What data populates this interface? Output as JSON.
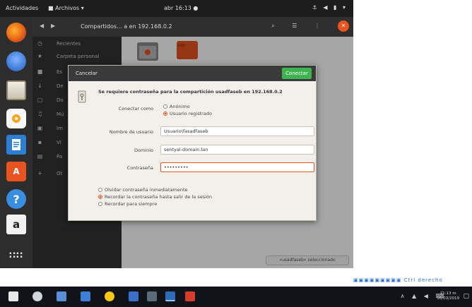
{
  "topbar": {
    "activities": "Actividades",
    "app_menu": "■ Archivos ▾",
    "clock": "abr 16:13 ●",
    "tray_icons": "⚓ ◀ ▮ ▾"
  },
  "dock": {
    "items": [
      {
        "name": "Firefox",
        "icon": "firefox-icon"
      },
      {
        "name": "Thunderbird",
        "icon": "thunderbird-icon"
      },
      {
        "name": "Archivos",
        "icon": "files-icon"
      },
      {
        "name": "Rhythmbox",
        "icon": "rhythmbox-icon"
      },
      {
        "name": "LibreOffice Writer",
        "icon": "writer-icon"
      },
      {
        "name": "Ubuntu Software",
        "icon": "software-icon",
        "glyph": "A"
      },
      {
        "name": "Ayuda",
        "icon": "help-icon",
        "glyph": "?"
      },
      {
        "name": "Amazon",
        "icon": "amazon-icon",
        "glyph": "a"
      },
      {
        "name": "Mostrar aplicaciones",
        "icon": "apps-grid-icon",
        "glyph": "∷∷"
      }
    ]
  },
  "files": {
    "path": "Compartidos... a en 192.168.0.2",
    "header_icons": "⌕ ☰ ⋮",
    "sidebar": [
      {
        "icon": "◷",
        "label": "Recientes"
      },
      {
        "icon": "★",
        "label": "Carpeta personal"
      },
      {
        "icon": "■",
        "label": "Es"
      },
      {
        "icon": "↓",
        "label": "De"
      },
      {
        "icon": "□",
        "label": "Do"
      },
      {
        "icon": "♫",
        "label": "Mú"
      },
      {
        "icon": "▣",
        "label": "Im"
      },
      {
        "icon": "▪",
        "label": "Ví"
      },
      {
        "icon": "▤",
        "label": "Pa"
      },
      {
        "icon": "+",
        "label": "Ot"
      }
    ],
    "status": "«usadfaseb» seleccionado"
  },
  "dialog": {
    "cancel": "Cancelar",
    "connect": "Conectar",
    "title": "Se requiere contraseña para la compartición usadfaseb en 192.168.0.2",
    "connect_as_label": "Conectar como",
    "option_anonymous": "Anónimo",
    "option_registered": "Usuario registrado",
    "username_label": "Nombre de usuario",
    "username_value": "Usuario\\fasadfaseb",
    "domain_label": "Dominio",
    "domain_value": "sentyal-domain.lan",
    "password_label": "Contraseña",
    "password_value": "•••••••••",
    "remember_forget": "Olvidar contraseña inmediatamente",
    "remember_session": "Recordar la contraseña hasta salir de la sesión",
    "remember_forever": "Recordar para siempre"
  },
  "taskbar": {
    "tray": "∧ ▲ ◀ ⌨",
    "clock_time": "21:13 m",
    "clock_date": "16/03/2019",
    "notif": "▢"
  },
  "vbox_statusbar": "▣▣▣▣▣▣▣▣▣ Ctrl derecho"
}
